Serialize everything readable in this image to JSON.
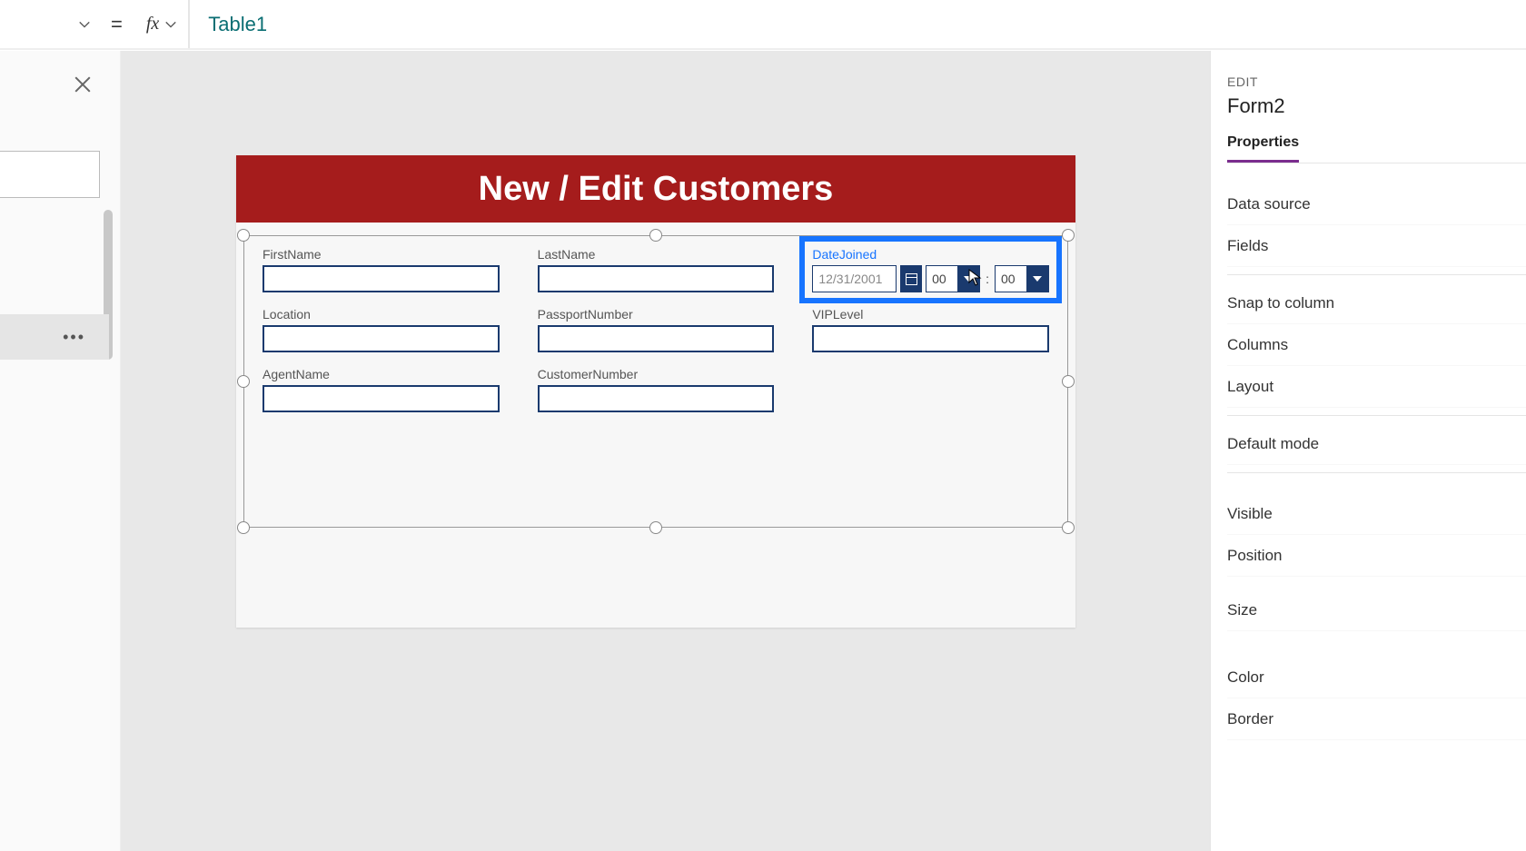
{
  "formula": {
    "text": "Table1",
    "fx": "fx"
  },
  "canvas": {
    "header": "New / Edit Customers",
    "fields": {
      "first_name": "FirstName",
      "last_name": "LastName",
      "date_joined": "DateJoined",
      "date_value": "12/31/2001",
      "hour_value": "00",
      "minute_value": "00",
      "colon": ":",
      "location": "Location",
      "passport_number": "PassportNumber",
      "vip_level": "VIPLevel",
      "agent_name": "AgentName",
      "customer_number": "CustomerNumber"
    }
  },
  "right": {
    "edit": "EDIT",
    "name": "Form2",
    "tab_properties": "Properties",
    "props": {
      "data_source": "Data source",
      "fields": "Fields",
      "snap": "Snap to column",
      "columns": "Columns",
      "layout": "Layout",
      "default_mode": "Default mode",
      "visible": "Visible",
      "position": "Position",
      "size": "Size",
      "color": "Color",
      "border": "Border"
    }
  }
}
